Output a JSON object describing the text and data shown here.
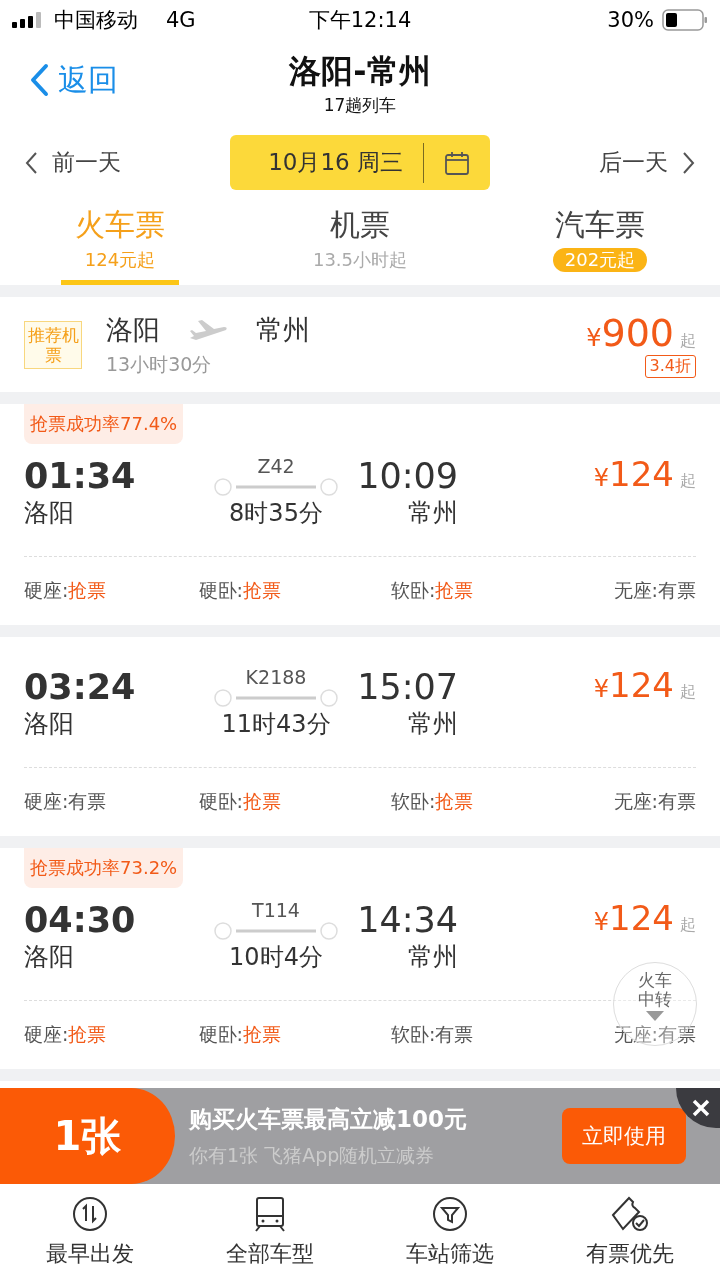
{
  "status_bar": {
    "carrier": "中国移动",
    "network": "4G",
    "time": "下午12:14",
    "battery": "30%"
  },
  "header": {
    "back": "返回",
    "title": "洛阳-常州",
    "subtitle": "17趟列车"
  },
  "date_bar": {
    "prev": "前一天",
    "date": "10月16 周三",
    "next": "后一天"
  },
  "tabs": [
    {
      "label": "火车票",
      "sub": "124元起",
      "selected": true,
      "highlight": false
    },
    {
      "label": "机票",
      "sub": "13.5小时起",
      "selected": false,
      "highlight": false
    },
    {
      "label": "汽车票",
      "sub": "202元起",
      "selected": false,
      "highlight": true
    }
  ],
  "flight": {
    "tag": "推荐机票",
    "from": "洛阳",
    "to": "常州",
    "duration": "13小时30分",
    "currency": "¥",
    "price": "900",
    "suffix": "起",
    "discount": "3.4折"
  },
  "trains": [
    {
      "badge": "抢票成功率77.4%",
      "depart": "01:34",
      "from": "洛阳",
      "train": "Z42",
      "duration": "8时35分",
      "arrive": "10:09",
      "to": "常州",
      "currency": "¥",
      "price": "124",
      "suffix": "起",
      "seats": [
        {
          "label": "硬座:",
          "status": "抢票",
          "grab": true
        },
        {
          "label": "硬卧:",
          "status": "抢票",
          "grab": true
        },
        {
          "label": "软卧:",
          "status": "抢票",
          "grab": true
        },
        {
          "label": "无座:",
          "status": "有票",
          "grab": false
        }
      ]
    },
    {
      "depart": "03:24",
      "from": "洛阳",
      "train": "K2188",
      "duration": "11时43分",
      "arrive": "15:07",
      "to": "常州",
      "currency": "¥",
      "price": "124",
      "suffix": "起",
      "seats": [
        {
          "label": "硬座:",
          "status": "有票",
          "grab": false
        },
        {
          "label": "硬卧:",
          "status": "抢票",
          "grab": true
        },
        {
          "label": "软卧:",
          "status": "抢票",
          "grab": true
        },
        {
          "label": "无座:",
          "status": "有票",
          "grab": false
        }
      ]
    },
    {
      "badge": "抢票成功率73.2%",
      "depart": "04:30",
      "from": "洛阳",
      "train": "T114",
      "duration": "10时4分",
      "arrive": "14:34",
      "to": "常州",
      "currency": "¥",
      "price": "124",
      "suffix": "起",
      "seats": [
        {
          "label": "硬座:",
          "status": "抢票",
          "grab": true
        },
        {
          "label": "硬卧:",
          "status": "抢票",
          "grab": true
        },
        {
          "label": "软卧:",
          "status": "有票",
          "grab": false
        },
        {
          "label": "无座:",
          "status": "有票",
          "grab": false
        }
      ]
    }
  ],
  "transfer_button": "火车中转",
  "promo": {
    "count": "1张",
    "title": "购买火车票最高立减100元",
    "subtitle": "你有1张 飞猪App随机立减券",
    "action": "立即使用"
  },
  "bottom_nav": [
    {
      "label": "最早出发"
    },
    {
      "label": "全部车型"
    },
    {
      "label": "车站筛选"
    },
    {
      "label": "有票优先"
    }
  ]
}
